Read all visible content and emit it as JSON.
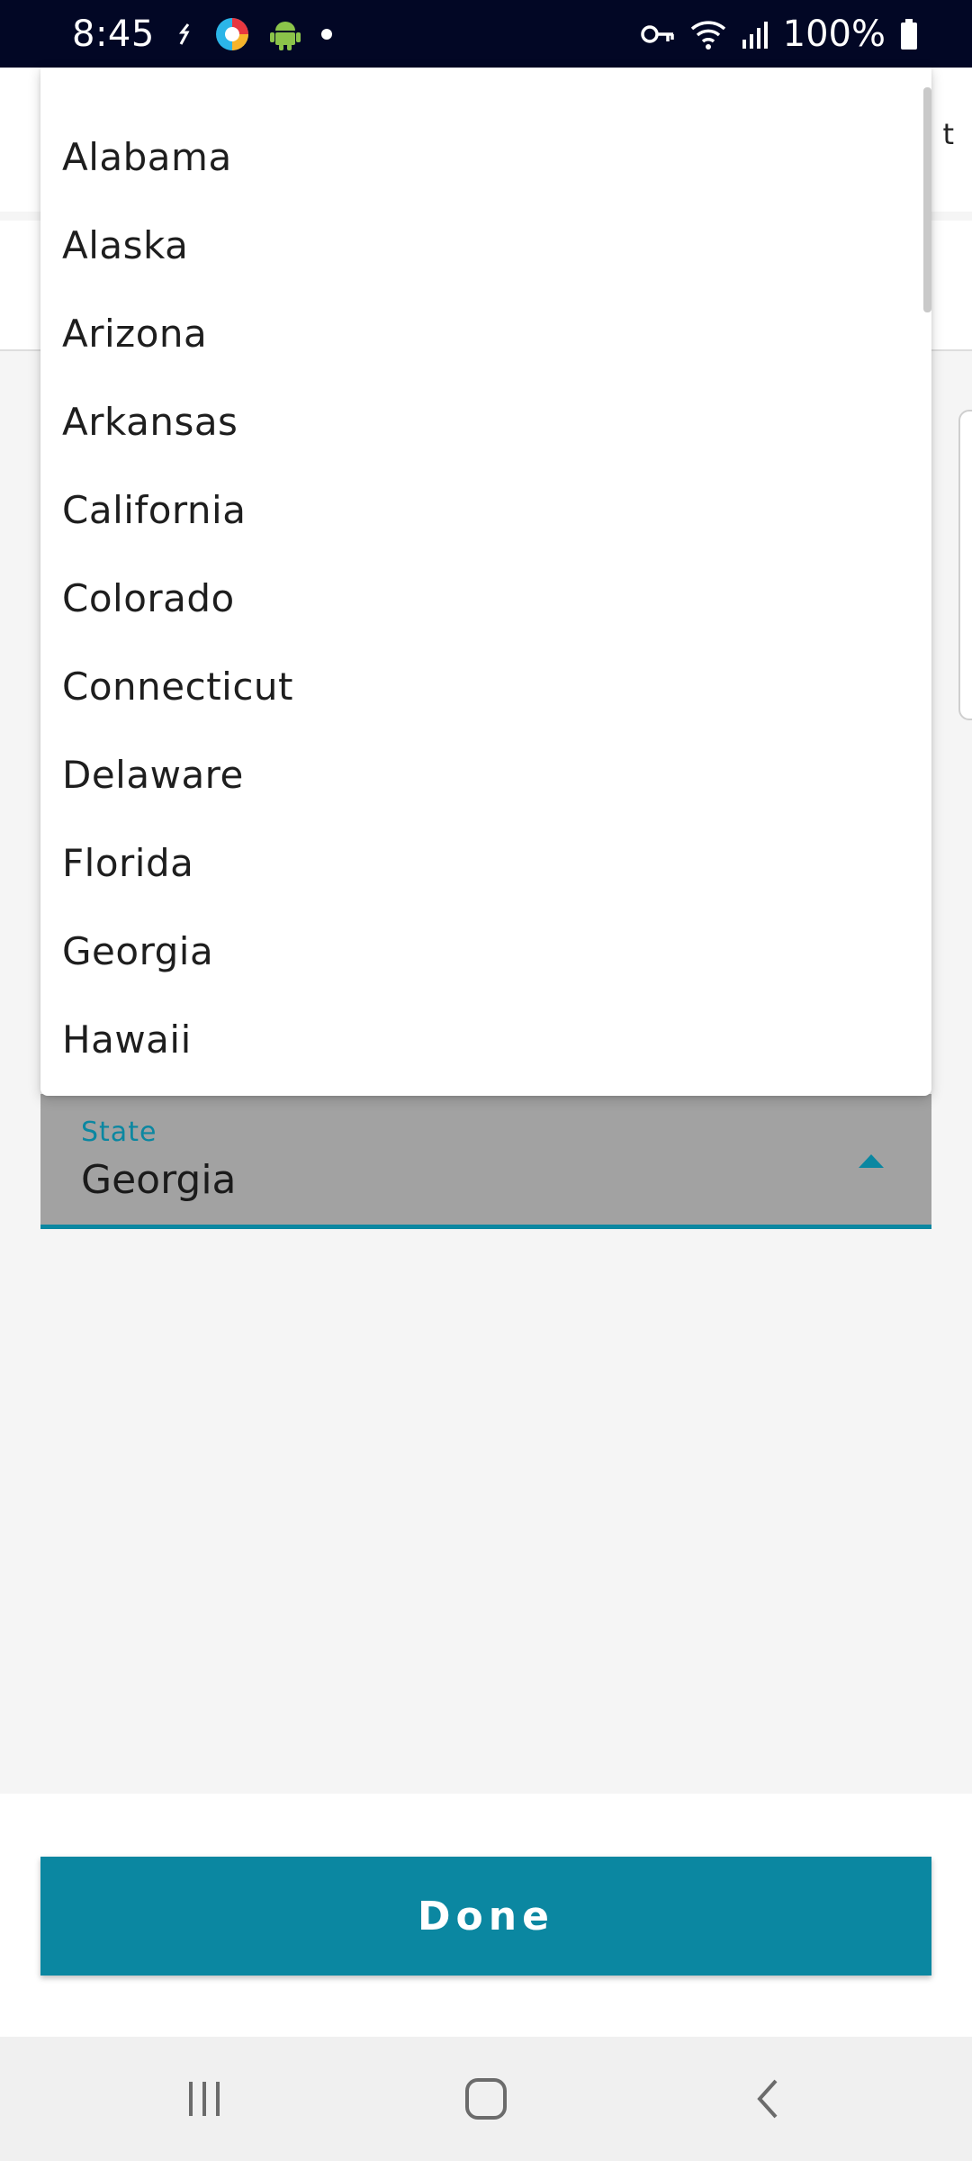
{
  "status_bar": {
    "time": "8:45",
    "battery": "100%",
    "icons": [
      "sync-icon",
      "browser-app-icon",
      "android-icon",
      "notification-dot-icon",
      "vpn-key-icon",
      "wifi-icon",
      "signal-icon",
      "battery-icon"
    ]
  },
  "background": {
    "header_trailing_text": "t"
  },
  "dropdown": {
    "options": [
      "Alabama",
      "Alaska",
      "Arizona",
      "Arkansas",
      "California",
      "Colorado",
      "Connecticut",
      "Delaware",
      "Florida",
      "Georgia",
      "Hawaii"
    ]
  },
  "state_field": {
    "label": "State",
    "value": "Georgia"
  },
  "actions": {
    "done_label": "Done"
  },
  "nav_bar": {
    "icons": [
      "recent-apps-icon",
      "home-icon",
      "back-icon"
    ]
  },
  "colors": {
    "accent": "#0b87a1",
    "status_bar": "#020725",
    "field_background": "#a2a2a2"
  }
}
